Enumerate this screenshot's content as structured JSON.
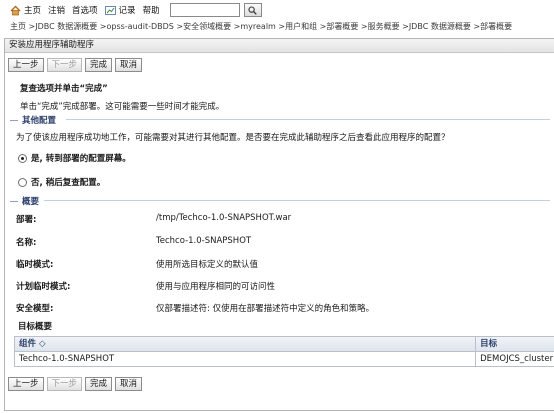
{
  "toolbar": {
    "home": "主页",
    "logout": "注销",
    "preferences": "首选项",
    "record": "记录",
    "help": "帮助",
    "search_value": ""
  },
  "breadcrumb": "主页 >JDBC 数据源概要 >opss-audit-DBDS >安全领域概要 >myrealm >用户和组 >部署概要 >服务概要 >JDBC 数据源概要 >部署概要",
  "panel": {
    "title": "安装应用程序辅助程序",
    "buttons": {
      "back": "上一步",
      "next": "下一步",
      "finish": "完成",
      "cancel": "取消"
    },
    "heading": "复查选项并单击“完成”",
    "instruction": "单击“完成”完成部署。这可能需要一些时间才能完成。",
    "other_config": {
      "title": "其他配置",
      "question": "为了使该应用程序成功地工作，可能需要对其进行其他配置。是否要在完成此辅助程序之后查看此应用程序的配置？",
      "option_yes": "是, 转到部署的配置屏幕。",
      "option_no": "否, 稍后复查配置。"
    },
    "summary": {
      "title": "概要",
      "rows": [
        {
          "label": "部署:",
          "value": "/tmp/Techco-1.0-SNAPSHOT.war"
        },
        {
          "label": "名称:",
          "value": "Techco-1.0-SNAPSHOT"
        },
        {
          "label": "临时模式:",
          "value": "使用所选目标定义的默认值"
        },
        {
          "label": "计划临时模式:",
          "value": "使用与应用程序相同的可访问性"
        },
        {
          "label": "安全模型:",
          "value": "仅部署描述符: 仅使用在部署描述符中定义的角色和策略。"
        }
      ],
      "target_summary": "目标概要",
      "table": {
        "headers": [
          "组件 ◇",
          "目标"
        ],
        "rows": [
          [
            "Techco-1.0-SNAPSHOT",
            "DEMOJCS_cluster"
          ]
        ]
      }
    }
  }
}
